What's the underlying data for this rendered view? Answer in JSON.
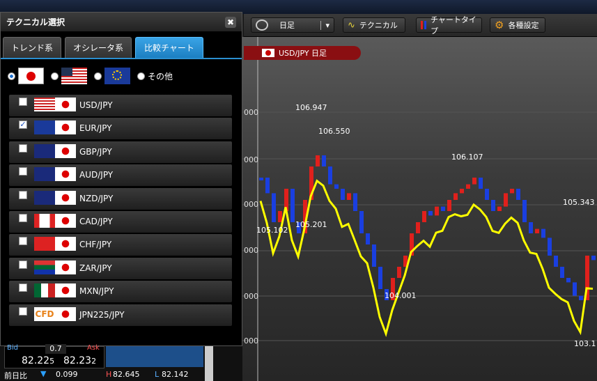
{
  "panel": {
    "title": "テクニカル選択",
    "close_glyph": "✖",
    "tabs": [
      "トレンド系",
      "オシレータ系",
      "比較チャート"
    ],
    "active_tab": 2,
    "base_currencies": {
      "other_label": "その他",
      "selected": "JPY"
    },
    "pairs": [
      {
        "label": "USD/JPY",
        "checked": false
      },
      {
        "label": "EUR/JPY",
        "checked": true
      },
      {
        "label": "GBP/JPY",
        "checked": false
      },
      {
        "label": "AUD/JPY",
        "checked": false
      },
      {
        "label": "NZD/JPY",
        "checked": false
      },
      {
        "label": "CAD/JPY",
        "checked": false
      },
      {
        "label": "CHF/JPY",
        "checked": false
      },
      {
        "label": "ZAR/JPY",
        "checked": false
      },
      {
        "label": "MXN/JPY",
        "checked": false
      },
      {
        "label": "JPN225/JPY",
        "checked": false
      }
    ]
  },
  "toolbar": {
    "period_label": "日足",
    "technical_label": "テクニカル",
    "chart_type_label": "チャートタイプ",
    "settings_label": "各種設定"
  },
  "chart": {
    "tag_label": "USD/JPY 日足",
    "axis_fragments": [
      "000",
      "000",
      "000",
      "000",
      "000",
      "000"
    ],
    "annotations": [
      "106.947",
      "106.550",
      "106.107",
      "105.343",
      "105.102",
      "105.201",
      "104.001",
      "103.1"
    ]
  },
  "rate_box": {
    "bid_label": "Bid",
    "ask_label": "Ask",
    "spread": "0.7",
    "bid_main": "82.22",
    "bid_small": "5",
    "ask_main": "82.23",
    "ask_small": "2",
    "change_label": "前日比",
    "change_value": "0.099",
    "high_label": "H",
    "high_value": "82.645",
    "low_label": "L",
    "low_value": "82.142"
  },
  "colors": {
    "accent": "#2a8fd0",
    "candle_up": "#e0201c",
    "candle_down": "#1a3fe0",
    "line": "#ffff00",
    "chart_tag": "#8a0f12"
  }
}
